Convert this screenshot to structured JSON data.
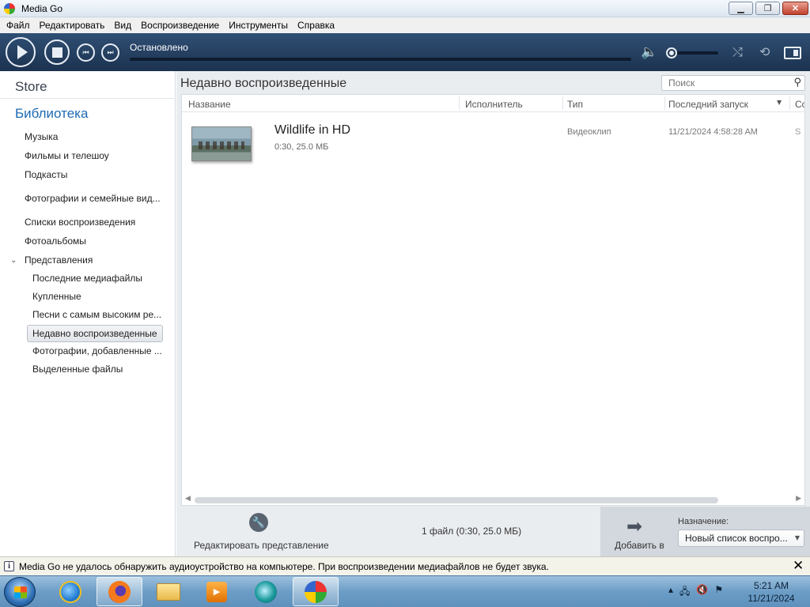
{
  "window": {
    "title": "Media Go",
    "controls": [
      "minimize-icon",
      "restore-icon",
      "close-icon"
    ]
  },
  "menu": [
    "Файл",
    "Редактировать",
    "Вид",
    "Воспроизведение",
    "Инструменты",
    "Справка"
  ],
  "transport": {
    "status": "Остановлено",
    "buttons": [
      "play-icon",
      "stop-icon",
      "previous-icon",
      "next-icon"
    ],
    "icons": [
      "volume-icon",
      "shuffle-icon",
      "repeat-icon",
      "layout-icon"
    ]
  },
  "sidebar": {
    "store": "Store",
    "library": "Библиотека",
    "items": [
      "Музыка",
      "Фильмы и телешоу",
      "Подкасты",
      "Фотографии и семейные вид...",
      "Списки воспроизведения",
      "Фотоальбомы",
      "Представления"
    ],
    "views": [
      "Последние медиафайлы",
      "Купленные",
      "Песни с самым высоким ре...",
      "Недавно воспроизведенные",
      "Фотографии, добавленные ...",
      "Выделенные файлы"
    ],
    "selected_view": "Недавно воспроизведенные"
  },
  "main": {
    "title": "Недавно воспроизведенные",
    "search_placeholder": "Поиск",
    "columns": [
      "Название",
      "Исполнитель",
      "Тип",
      "Последний запуск",
      "Со"
    ],
    "rows": [
      {
        "title": "Wildlife in HD",
        "details": "0:30, 25.0 МБ",
        "type": "Видеоклип",
        "last_played": "11/21/2024 4:58:28 AM",
        "extra": "S"
      }
    ]
  },
  "bottom": {
    "edit_view": "Редактировать представление",
    "summary": "1 файл (0:30, 25.0 МБ)",
    "add_to": "Добавить в",
    "destination_label": "Назначение:",
    "destination_value": "Новый список воспро..."
  },
  "notification": {
    "text": "Media Go не удалось обнаружить аудиоустройство на компьютере. При воспроизведении медиафайлов не будет звука."
  },
  "taskbar": {
    "apps": [
      "internet-explorer-icon",
      "firefox-icon",
      "folder-icon",
      "media-player-icon",
      "windows-media-player-icon",
      "media-go-icon"
    ],
    "time": "5:21 AM",
    "date": "11/21/2024"
  }
}
